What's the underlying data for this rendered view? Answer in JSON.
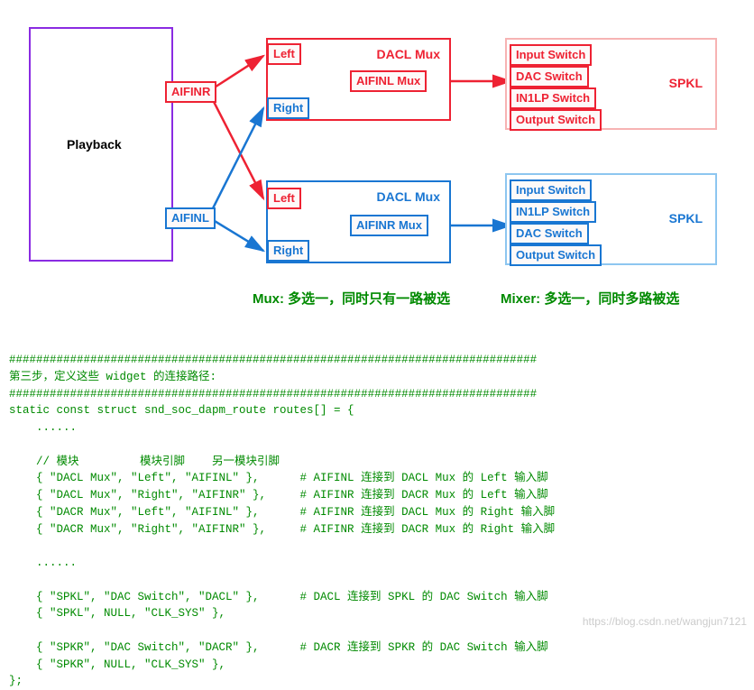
{
  "playback": {
    "label": "Playback",
    "aifinr": "AIFINR",
    "aifinl": "AIFINL"
  },
  "topMux": {
    "title": "DACL Mux",
    "left": "Left",
    "right": "Right",
    "sub": "AIFINL Mux"
  },
  "bottomMux": {
    "title": "DACL Mux",
    "left": "Left",
    "right": "Right",
    "sub": "AIFINR Mux"
  },
  "topMixer": {
    "title": "SPKL",
    "items": [
      "Input Switch",
      "DAC Switch",
      "IN1LP Switch",
      "Output Switch"
    ]
  },
  "bottomMixer": {
    "title": "SPKL",
    "items": [
      "Input Switch",
      "IN1LP Switch",
      "DAC Switch",
      "Output Switch"
    ]
  },
  "captions": {
    "mux": "Mux: 多选一，同时只有一路被选",
    "mixer": "Mixer: 多选一，同时多路被选"
  },
  "code": {
    "hr": "##############################################################################",
    "step": "第三步，定义这些 widget 的连接路径:",
    "decl": "static const struct snd_soc_dapm_route routes[] = {",
    "dots": "    ......",
    "comment_header": "    // 模块         模块引脚    另一模块引脚",
    "r1": "    { \"DACL Mux\", \"Left\", \"AIFINL\" },      # AIFINL 连接到 DACL Mux 的 Left 输入脚",
    "r2": "    { \"DACL Mux\", \"Right\", \"AIFINR\" },     # AIFINR 连接到 DACR Mux 的 Left 输入脚",
    "r3": "    { \"DACR Mux\", \"Left\", \"AIFINL\" },      # AIFINR 连接到 DACL Mux 的 Right 输入脚",
    "r4": "    { \"DACR Mux\", \"Right\", \"AIFINR\" },     # AIFINR 连接到 DACR Mux 的 Right 输入脚",
    "r5": "    { \"SPKL\", \"DAC Switch\", \"DACL\" },      # DACL 连接到 SPKL 的 DAC Switch 输入脚",
    "r6": "    { \"SPKL\", NULL, \"CLK_SYS\" },",
    "r7": "    { \"SPKR\", \"DAC Switch\", \"DACR\" },      # DACR 连接到 SPKR 的 DAC Switch 输入脚",
    "r8": "    { \"SPKR\", NULL, \"CLK_SYS\" },",
    "end": "};"
  },
  "watermark": "https://blog.csdn.net/wangjun7121"
}
